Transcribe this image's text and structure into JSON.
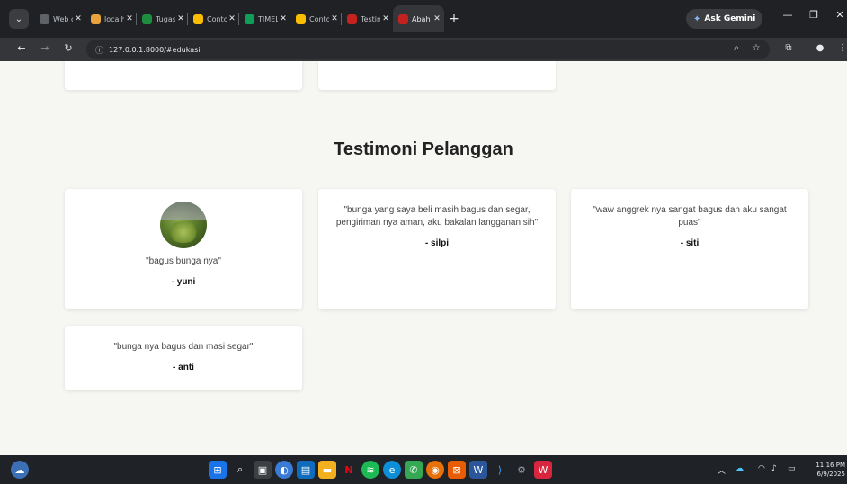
{
  "browser": {
    "tabs": [
      {
        "title": "Web de",
        "color": "#5f6368"
      },
      {
        "title": "localho",
        "color": "#e8a33d"
      },
      {
        "title": "Tugas",
        "color": "#1e8e3e"
      },
      {
        "title": "Contoh",
        "color": "#fbbc04"
      },
      {
        "title": "TIMELI",
        "color": "#0f9d58"
      },
      {
        "title": "Contoh",
        "color": "#fbbc04"
      },
      {
        "title": "Testimo",
        "color": "#c5221f"
      },
      {
        "title": "Abah C",
        "color": "#c5221f"
      }
    ],
    "active_tab": 7,
    "close_glyph": "✕",
    "new_tab": "+",
    "ask_gemini": "Ask Gemini",
    "url": "127.0.0.1:8000/#edukasi"
  },
  "section": {
    "title": "Testimoni Pelanggan"
  },
  "testimonials": [
    {
      "quote": "\"bagus bunga nya\"",
      "author": "- yuni"
    },
    {
      "quote": "\"bunga yang saya beli masih bagus dan segar, pengiriman nya aman, aku bakalan langganan sih\"",
      "author": "- silpi"
    },
    {
      "quote": "\"waw anggrek nya sangat bagus dan aku sangat puas\"",
      "author": "- siti"
    },
    {
      "quote": "\"bunga nya bagus dan masi segar\"",
      "author": "- anti"
    }
  ],
  "taskbar": {
    "time": "11:16 PM",
    "date": "6/9/2025"
  },
  "colors": {
    "page_bg": "#f6f7f3",
    "card_bg": "#ffffff",
    "chrome_dark": "#202124",
    "taskbar": "#1f2226"
  }
}
